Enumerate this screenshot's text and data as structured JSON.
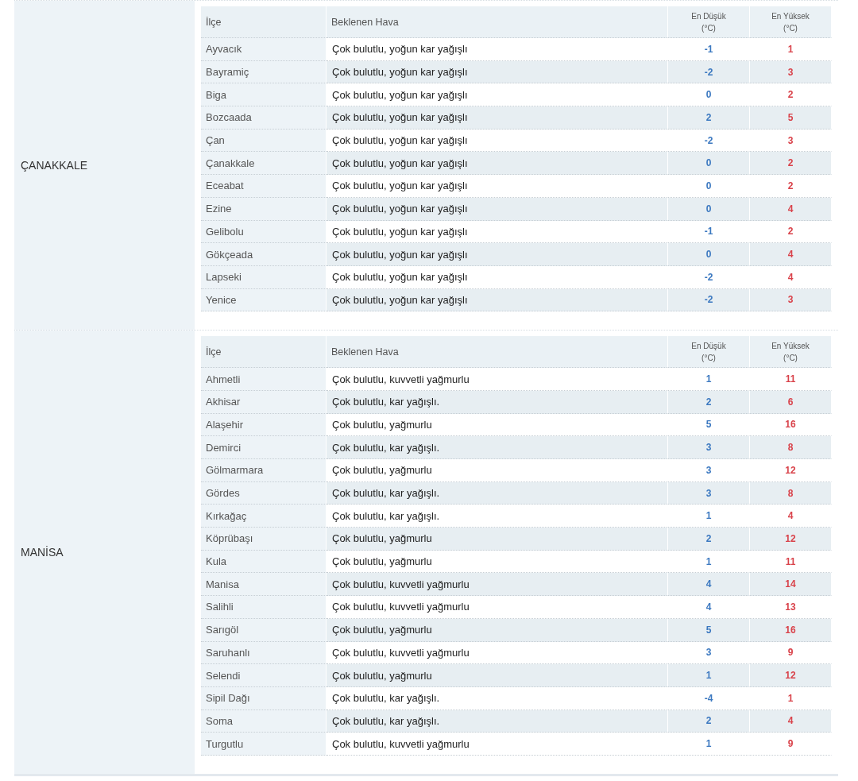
{
  "sections": [
    {
      "province": "ÇANAKKALE",
      "columns": [
        "İlçe",
        "Beklenen Hava",
        "En Düşük\n(°C)",
        "En Yüksek\n(°C)"
      ],
      "rows": [
        {
          "district": "Ayvacık",
          "forecast": "Çok bulutlu, yoğun kar yağışlı",
          "low": "-1",
          "high": "1"
        },
        {
          "district": "Bayramiç",
          "forecast": "Çok bulutlu, yoğun kar yağışlı",
          "low": "-2",
          "high": "3"
        },
        {
          "district": "Biga",
          "forecast": "Çok bulutlu, yoğun kar yağışlı",
          "low": "0",
          "high": "2"
        },
        {
          "district": "Bozcaada",
          "forecast": "Çok bulutlu, yoğun kar yağışlı",
          "low": "2",
          "high": "5"
        },
        {
          "district": "Çan",
          "forecast": "Çok bulutlu, yoğun kar yağışlı",
          "low": "-2",
          "high": "3"
        },
        {
          "district": "Çanakkale",
          "forecast": "Çok bulutlu, yoğun kar yağışlı",
          "low": "0",
          "high": "2"
        },
        {
          "district": "Eceabat",
          "forecast": "Çok bulutlu, yoğun kar yağışlı",
          "low": "0",
          "high": "2"
        },
        {
          "district": "Ezine",
          "forecast": "Çok bulutlu, yoğun kar yağışlı",
          "low": "0",
          "high": "4"
        },
        {
          "district": "Gelibolu",
          "forecast": "Çok bulutlu, yoğun kar yağışlı",
          "low": "-1",
          "high": "2"
        },
        {
          "district": "Gökçeada",
          "forecast": "Çok bulutlu, yoğun kar yağışlı",
          "low": "0",
          "high": "4"
        },
        {
          "district": "Lapseki",
          "forecast": "Çok bulutlu, yoğun kar yağışlı",
          "low": "-2",
          "high": "4"
        },
        {
          "district": "Yenice",
          "forecast": "Çok bulutlu, yoğun kar yağışlı",
          "low": "-2",
          "high": "3"
        }
      ]
    },
    {
      "province": "MANİSA",
      "columns": [
        "İlçe",
        "Beklenen Hava",
        "En Düşük\n(°C)",
        "En Yüksek\n(°C)"
      ],
      "rows": [
        {
          "district": "Ahmetli",
          "forecast": "Çok bulutlu, kuvvetli yağmurlu",
          "low": "1",
          "high": "11"
        },
        {
          "district": "Akhisar",
          "forecast": "Çok bulutlu, kar yağışlı.",
          "low": "2",
          "high": "6"
        },
        {
          "district": "Alaşehir",
          "forecast": "Çok bulutlu, yağmurlu",
          "low": "5",
          "high": "16"
        },
        {
          "district": "Demirci",
          "forecast": "Çok bulutlu, kar yağışlı.",
          "low": "3",
          "high": "8"
        },
        {
          "district": "Gölmarmara",
          "forecast": "Çok bulutlu, yağmurlu",
          "low": "3",
          "high": "12"
        },
        {
          "district": "Gördes",
          "forecast": "Çok bulutlu, kar yağışlı.",
          "low": "3",
          "high": "8"
        },
        {
          "district": "Kırkağaç",
          "forecast": "Çok bulutlu, kar yağışlı.",
          "low": "1",
          "high": "4"
        },
        {
          "district": "Köprübaşı",
          "forecast": "Çok bulutlu, yağmurlu",
          "low": "2",
          "high": "12"
        },
        {
          "district": "Kula",
          "forecast": "Çok bulutlu, yağmurlu",
          "low": "1",
          "high": "11"
        },
        {
          "district": "Manisa",
          "forecast": "Çok bulutlu, kuvvetli yağmurlu",
          "low": "4",
          "high": "14"
        },
        {
          "district": "Salihli",
          "forecast": "Çok bulutlu, kuvvetli yağmurlu",
          "low": "4",
          "high": "13"
        },
        {
          "district": "Sarıgöl",
          "forecast": "Çok bulutlu, yağmurlu",
          "low": "5",
          "high": "16"
        },
        {
          "district": "Saruhanlı",
          "forecast": "Çok bulutlu, kuvvetli yağmurlu",
          "low": "3",
          "high": "9"
        },
        {
          "district": "Selendi",
          "forecast": "Çok bulutlu, yağmurlu",
          "low": "1",
          "high": "12"
        },
        {
          "district": "Sipil Dağı",
          "forecast": "Çok bulutlu, kar yağışlı.",
          "low": "-4",
          "high": "1"
        },
        {
          "district": "Soma",
          "forecast": "Çok bulutlu, kar yağışlı.",
          "low": "2",
          "high": "4"
        },
        {
          "district": "Turgutlu",
          "forecast": "Çok bulutlu, kuvvetli yağmurlu",
          "low": "1",
          "high": "9"
        }
      ]
    }
  ]
}
